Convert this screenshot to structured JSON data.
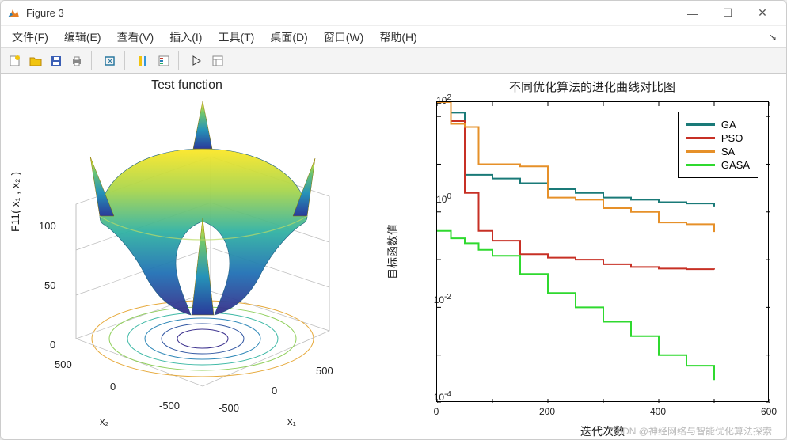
{
  "window": {
    "title": "Figure 3"
  },
  "menus": {
    "file": "文件(F)",
    "edit": "编辑(E)",
    "view": "查看(V)",
    "insert": "插入(I)",
    "tools": "工具(T)",
    "desktop": "桌面(D)",
    "window": "窗口(W)",
    "help": "帮助(H)"
  },
  "left_plot": {
    "title": "Test function",
    "zlabel_full": "F11( x₁ , x₂ )",
    "zticks": [
      "0",
      "50",
      "100"
    ],
    "x1_label": "x₁",
    "x2_label": "x₂",
    "axis_ticks": [
      "-500",
      "0",
      "500"
    ]
  },
  "right_plot": {
    "title": "不同优化算法的进化曲线对比图",
    "ylabel": "目标函数值",
    "xlabel": "迭代次数",
    "xticks": [
      "0",
      "200",
      "400",
      "600"
    ],
    "ytick_exp": [
      "10^{-4}",
      "10^{-2}",
      "10^{0}",
      "10^{2}"
    ],
    "legend": {
      "GA": {
        "label": "GA",
        "color": "#1a7a78"
      },
      "PSO": {
        "label": "PSO",
        "color": "#c73025"
      },
      "SA": {
        "label": "SA",
        "color": "#e69029"
      },
      "GASA": {
        "label": "GASA",
        "color": "#2fd92f"
      }
    }
  },
  "watermark": "CSDN @神经网络与智能优化算法探索",
  "chart_data": [
    {
      "type": "surface",
      "title": "Test function",
      "xlabel": "x1",
      "ylabel": "x2",
      "zlabel": "F11(x1,x2)",
      "xlim": [
        -500,
        500
      ],
      "ylim": [
        -500,
        500
      ],
      "zlim": [
        0,
        130
      ],
      "function_hint": "Schwefel-like test function surface with four sharp peaks at corners and central valley; contour rings on floor",
      "colormap": "parula"
    },
    {
      "type": "line",
      "title": "不同优化算法的进化曲线对比图",
      "xlabel": "迭代次数",
      "ylabel": "目标函数值",
      "xlim": [
        0,
        600
      ],
      "ylim": [
        0.0001,
        200
      ],
      "yscale": "log",
      "x": [
        0,
        25,
        50,
        75,
        100,
        150,
        200,
        250,
        300,
        350,
        400,
        450,
        500
      ],
      "series": [
        {
          "name": "GA",
          "color": "#1a7a78",
          "values": [
            200,
            120,
            6,
            6,
            5,
            4,
            3,
            2.5,
            2,
            1.8,
            1.6,
            1.5,
            1.3
          ]
        },
        {
          "name": "PSO",
          "color": "#c73025",
          "values": [
            200,
            80,
            2.5,
            0.4,
            0.25,
            0.13,
            0.11,
            0.1,
            0.08,
            0.07,
            0.065,
            0.063,
            0.062
          ]
        },
        {
          "name": "SA",
          "color": "#e69029",
          "values": [
            200,
            70,
            60,
            10,
            10,
            9,
            2,
            1.8,
            1.2,
            1.0,
            0.6,
            0.55,
            0.38
          ]
        },
        {
          "name": "GASA",
          "color": "#2fd92f",
          "values": [
            0.4,
            0.28,
            0.22,
            0.16,
            0.12,
            0.05,
            0.02,
            0.01,
            0.005,
            0.0025,
            0.001,
            0.0006,
            0.0003
          ]
        }
      ]
    }
  ]
}
